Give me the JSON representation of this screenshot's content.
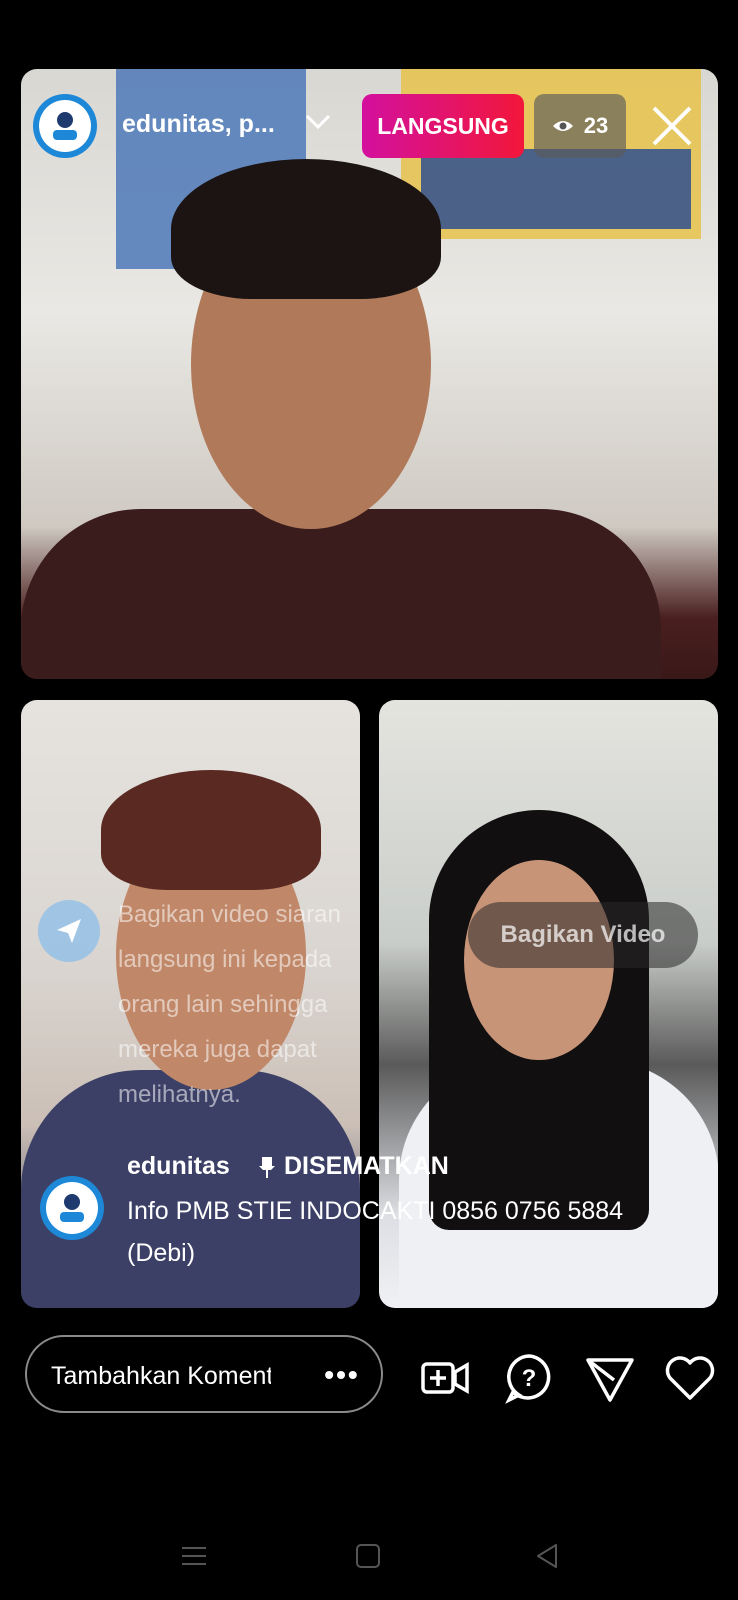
{
  "host": {
    "account_name": "edunitas, p...",
    "live_label": "LANGSUNG",
    "viewer_count": "23"
  },
  "overlay": {
    "share_message": "Bagikan video siaran langsung ini kepada orang lain sehingga mereka juga dapat melihatnya.",
    "share_video_label": "Bagikan Video"
  },
  "pinned": {
    "username": "edunitas",
    "label": "DISEMATKAN",
    "text": "Info PMB STIE INDOCAKTI 0856 0756 5884 (Debi)"
  },
  "bottom_bar": {
    "comment_placeholder": "Tambahkan Komentar",
    "more_label": "•••"
  },
  "icons": {
    "avatar": "edunitas-logo-icon",
    "eye": "eye-icon",
    "close": "close-icon",
    "pin": "pin-icon",
    "share": "send-icon",
    "add_video": "add-video-icon",
    "question": "question-icon",
    "like": "heart-icon"
  },
  "colors": {
    "live_gradient_start": "#d3109e",
    "live_gradient_end": "#f2173a",
    "avatar_blue": "#1e88d8"
  }
}
